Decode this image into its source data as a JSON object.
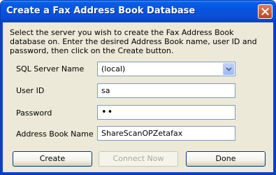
{
  "window": {
    "title": "Create a Fax Address Book Database"
  },
  "description": "Select the server you wish to create the Fax Address Book database on. Enter the desired Address Book name, user ID and password, then click on the Create button.",
  "form": {
    "server": {
      "label": "SQL Server Name",
      "value": "(local)"
    },
    "user_id": {
      "label": "User ID",
      "value": "sa"
    },
    "password": {
      "label": "Password",
      "value": "••"
    },
    "address_book": {
      "label": "Address Book Name",
      "value": "ShareScanOPZetafax"
    }
  },
  "buttons": {
    "create": "Create",
    "connect_now": "Connect Now",
    "done": "Done"
  },
  "colors": {
    "title_bar": "#0554e1",
    "close_button": "#d5582f",
    "dialog_background": "#ece9d8",
    "field_border": "#7f9db9"
  },
  "icons": {
    "close": "close-icon",
    "dropdown": "chevron-down-icon"
  }
}
